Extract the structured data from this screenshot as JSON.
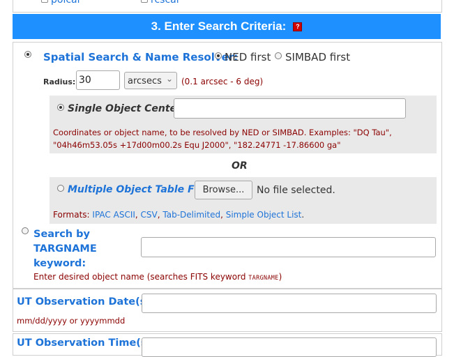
{
  "top_row": {
    "items": [
      {
        "label": "polcal",
        "checked": false
      },
      {
        "label": "rcscal",
        "checked": false
      }
    ]
  },
  "section": {
    "title": "3. Enter Search Criteria:",
    "help_icon_text": "?"
  },
  "spatial": {
    "label": "Spatial Search & Name Resolver:",
    "resolver_options": [
      {
        "label": "NED first",
        "selected": true
      },
      {
        "label": "SIMBAD first",
        "selected": false
      }
    ],
    "radius_label": "Radius:",
    "radius_value": "30",
    "radius_unit": "arcsecs",
    "radius_range": "(0.1 arcsec - 6 deg)"
  },
  "single_object": {
    "label": "Single Object Center:",
    "value": "",
    "hint_line1": "Coordinates or object name, to be resolved by NED or SIMBAD. Examples: \"DQ Tau\",",
    "hint_line2": "\"04h46m53.05s +17d00m00.2s Equ J2000\", \"182.24771 -17.86600 ga\""
  },
  "or_label": "OR",
  "multiple_object": {
    "label": "Multiple Object Table File:",
    "browse_label": "Browse...",
    "file_status": "No file selected.",
    "formats_label": "Formats:",
    "formats": [
      "IPAC ASCII",
      "CSV",
      "Tab-Delimited",
      "Simple Object List"
    ],
    "formats_end": "."
  },
  "targname": {
    "label_line1": "Search by",
    "label_line2": "TARGNAME",
    "label_line3": "keyword:",
    "value": "",
    "hint_prefix": "Enter desired object name (searches FITS keyword ",
    "hint_keyword": "TARGNAME",
    "hint_suffix": ")"
  },
  "obs_date": {
    "label": "UT Observation Date(s):",
    "value": "",
    "hint": "mm/dd/yyyy or yyyymmdd"
  },
  "obs_time": {
    "label": "UT Observation Time(s):"
  }
}
